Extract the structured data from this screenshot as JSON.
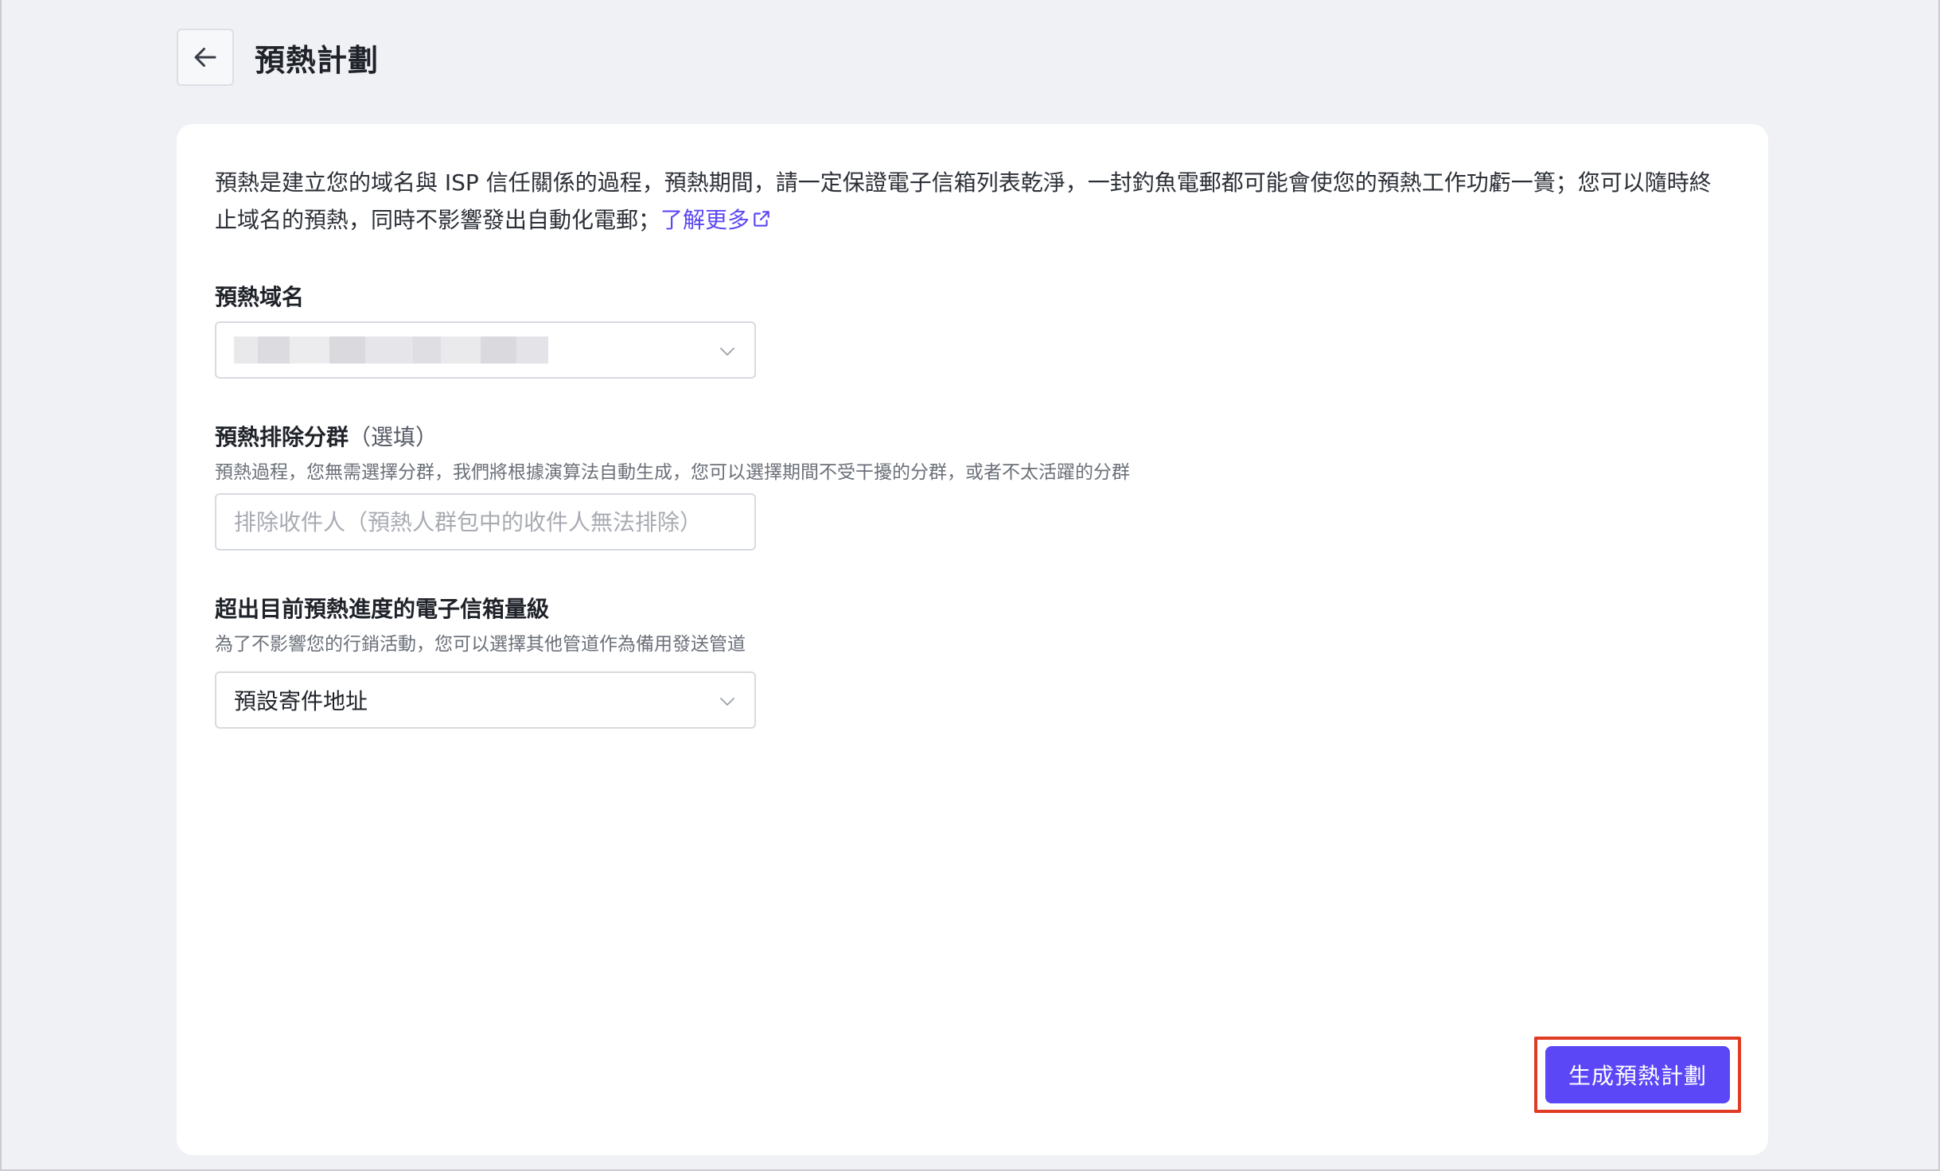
{
  "page": {
    "title": "預熱計劃",
    "back_icon": "arrow-left-icon"
  },
  "intro": {
    "text": "預熱是建立您的域名與 ISP 信任關係的過程，預熱期間，請一定保證電子信箱列表乾淨，一封釣魚電郵都可能會使您的預熱工作功虧一簣；您可以隨時終止域名的預熱，同時不影響發出自動化電郵；",
    "link_label": "了解更多",
    "link_icon": "external-link-icon"
  },
  "domain_field": {
    "label": "預熱域名",
    "value_obscured": true
  },
  "exclude_field": {
    "label": "預熱排除分群",
    "optional_label": "（選填）",
    "help": "預熱過程，您無需選擇分群，我們將根據演算法自動生成，您可以選擇期間不受干擾的分群，或者不太活躍的分群",
    "placeholder": "排除收件人（預熱人群包中的收件人無法排除）"
  },
  "overflow_field": {
    "label": "超出目前預熱進度的電子信箱量級",
    "help": "為了不影響您的行銷活動，您可以選擇其他管道作為備用發送管道",
    "value": "預設寄件地址"
  },
  "actions": {
    "generate_label": "生成預熱計劃"
  },
  "colors": {
    "accent": "#5b47f5",
    "highlight_border": "#e03b24",
    "background": "#f0f1f5"
  }
}
